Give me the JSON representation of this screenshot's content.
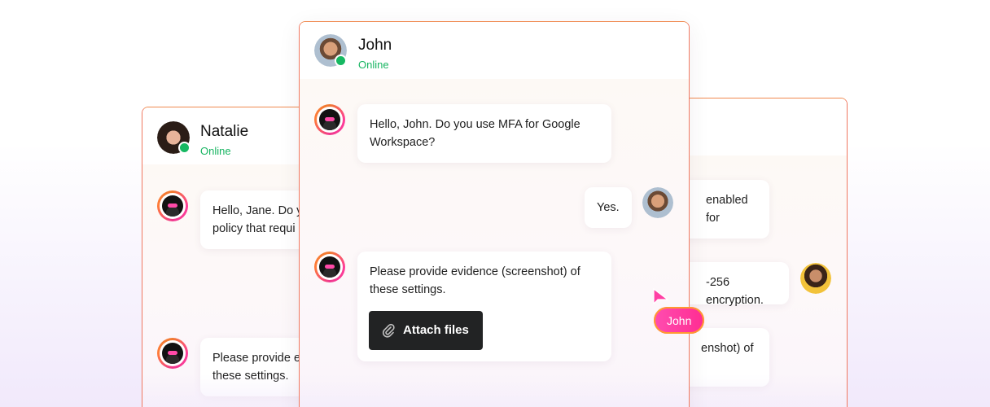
{
  "left_card": {
    "contact_name": "Natalie",
    "status": "Online",
    "messages": [
      {
        "text_line1": "Hello, Jane. Do y",
        "text_line2": "policy that requi"
      },
      {
        "text_line1": "Please provide e",
        "text_line2": "these settings."
      }
    ]
  },
  "center_card": {
    "contact_name": "John",
    "status": "Online",
    "messages": [
      {
        "from": "bot",
        "text": "Hello, John. Do you use MFA for Google Workspace?"
      },
      {
        "from": "user",
        "text": "Yes."
      },
      {
        "from": "bot",
        "text": "Please provide evidence (screenshot) of these settings."
      }
    ],
    "attach_label": "Attach files"
  },
  "right_card": {
    "messages": [
      {
        "text": "enabled for"
      },
      {
        "text": "-256 encryption."
      },
      {
        "text": "enshot) of"
      }
    ]
  },
  "cursor": {
    "label": "John"
  },
  "colors": {
    "online": "#16b862",
    "accent_pink": "#ff2d92",
    "accent_orange": "#f07a30"
  }
}
